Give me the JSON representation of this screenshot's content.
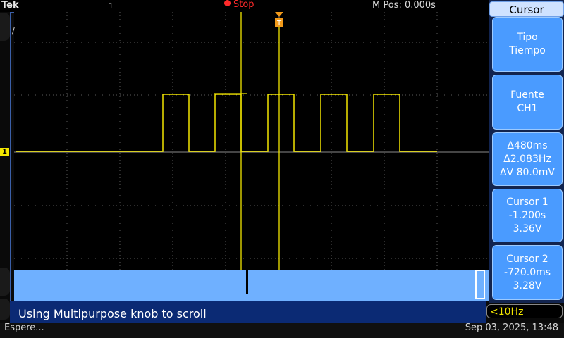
{
  "topbar": {
    "brand": "Tek",
    "trigger_glyph": "⎍",
    "run_state": "Stop",
    "mpos": "M Pos: 0.000s"
  },
  "channel_marker": "1",
  "left_glyph": "/",
  "message": "Using Multipurpose knob to scroll",
  "status": "Espere...",
  "datetime": "Sep 03, 2025, 13:48",
  "trigger_freq": "<10Hz",
  "cursor_menu": {
    "title": "Cursor",
    "buttons": [
      {
        "line1": "Tipo",
        "line2": "Tiempo",
        "line3": ""
      },
      {
        "line1": "Fuente",
        "line2": "CH1",
        "line3": ""
      },
      {
        "line1": "Δ480ms",
        "line2": "Δ2.083Hz",
        "line3": "ΔV 80.0mV"
      },
      {
        "line1": "Cursor 1",
        "line2": "-1.200s",
        "line3": "3.36V"
      },
      {
        "line1": "Cursor 2",
        "line2": "-720.0ms",
        "line3": "3.28V"
      }
    ]
  },
  "colors": {
    "trace": "#f2e600",
    "menu_button": "#4a9bff",
    "message_bar": "#0b2a74",
    "run_stop": "#ff2a2a"
  }
}
